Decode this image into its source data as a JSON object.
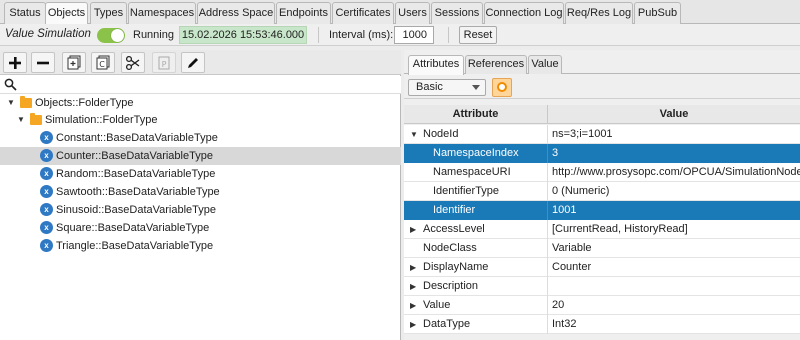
{
  "tabs": [
    "Status",
    "Objects",
    "Types",
    "Namespaces",
    "Address Space",
    "Endpoints",
    "Certificates",
    "Users",
    "Sessions",
    "Connection Log",
    "Req/Res Log",
    "PubSub"
  ],
  "sim": {
    "label": "Value Simulation",
    "state": "Running",
    "datetime": "15.02.2026 15:53:46.000",
    "interval_label": "Interval (ms):",
    "interval_value": "1000",
    "reset": "Reset"
  },
  "colors": {
    "accent": "#1a79b7",
    "toggle_on": "#8bc34a",
    "datetime_bg": "#c8e6c9",
    "folder": "#f5a623",
    "variable": "#2f78c4"
  },
  "toolbar_icons": [
    "plus-icon",
    "minus-icon",
    "add-object-icon",
    "add-copy-icon",
    "cut-icon",
    "paste-icon",
    "edit-icon"
  ],
  "tree": [
    {
      "label": "Objects::FolderType",
      "icon": "folder-icon",
      "depth": 0,
      "expanded": true
    },
    {
      "label": "Simulation::FolderType",
      "icon": "folder-icon",
      "depth": 1,
      "expanded": true
    },
    {
      "label": "Constant::BaseDataVariableType",
      "icon": "variable-icon",
      "depth": 2
    },
    {
      "label": "Counter::BaseDataVariableType",
      "icon": "variable-icon",
      "depth": 2,
      "selected": true
    },
    {
      "label": "Random::BaseDataVariableType",
      "icon": "variable-icon",
      "depth": 2
    },
    {
      "label": "Sawtooth::BaseDataVariableType",
      "icon": "variable-icon",
      "depth": 2
    },
    {
      "label": "Sinusoid::BaseDataVariableType",
      "icon": "variable-icon",
      "depth": 2
    },
    {
      "label": "Square::BaseDataVariableType",
      "icon": "variable-icon",
      "depth": 2
    },
    {
      "label": "Triangle::BaseDataVariableType",
      "icon": "variable-icon",
      "depth": 2
    }
  ],
  "right_tabs": [
    "Attributes",
    "References",
    "Value"
  ],
  "view_select": "Basic",
  "grid": {
    "headers": [
      "Attribute",
      "Value"
    ],
    "rows": [
      {
        "attribute": "NodeId",
        "value": "ns=3;i=1001",
        "expander": "down",
        "level": 0
      },
      {
        "attribute": "NamespaceIndex",
        "value": "3",
        "level": 1,
        "selected": true
      },
      {
        "attribute": "NamespaceURI",
        "value": "http://www.prosysopc.com/OPCUA/SimulationNodes/",
        "level": 1
      },
      {
        "attribute": "IdentifierType",
        "value": "0 (Numeric)",
        "level": 1
      },
      {
        "attribute": "Identifier",
        "value": "1001",
        "level": 1,
        "selected": true
      },
      {
        "attribute": "AccessLevel",
        "value": "[CurrentRead, HistoryRead]",
        "expander": "right",
        "level": 0
      },
      {
        "attribute": "NodeClass",
        "value": "Variable",
        "level": 0
      },
      {
        "attribute": "DisplayName",
        "value": "Counter",
        "expander": "right",
        "level": 0
      },
      {
        "attribute": "Description",
        "value": "",
        "expander": "right",
        "level": 0
      },
      {
        "attribute": "Value",
        "value": "20",
        "expander": "right",
        "level": 0
      },
      {
        "attribute": "DataType",
        "value": "Int32",
        "expander": "right",
        "level": 0
      }
    ]
  }
}
